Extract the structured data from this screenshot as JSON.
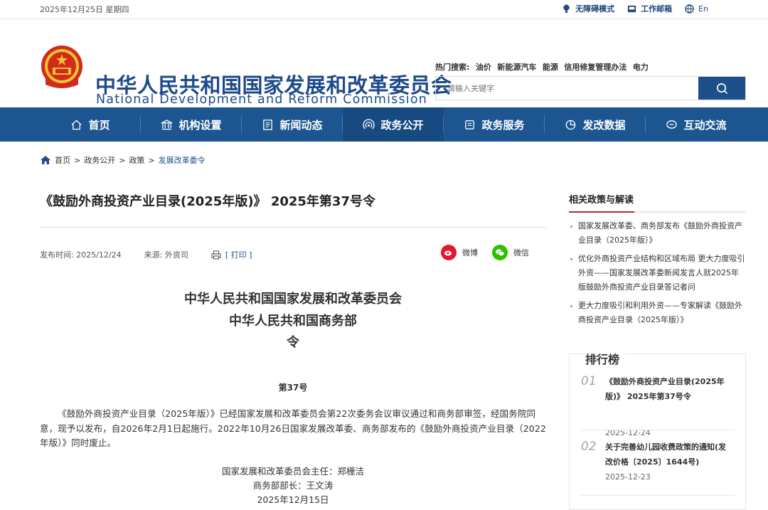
{
  "topbar": {
    "date": "2025年12月25日 星期四",
    "accessibility": "无障碍模式",
    "mail": "工作邮箱",
    "lang": "En"
  },
  "header": {
    "title_cn": "中华人民共和国国家发展和改革委员会",
    "title_en": "National Development and Reform Commission",
    "hot_label": "热门搜索:",
    "hot_keywords": [
      "油价",
      "新能源汽车",
      "能源",
      "信用修复管理办法",
      "电力"
    ],
    "search_placeholder": "请输入关键字"
  },
  "nav": {
    "items": [
      {
        "label": "首页",
        "icon": "home-icon"
      },
      {
        "label": "机构设置",
        "icon": "building-icon"
      },
      {
        "label": "新闻动态",
        "icon": "news-icon"
      },
      {
        "label": "政务公开",
        "icon": "broadcast-icon"
      },
      {
        "label": "政务服务",
        "icon": "service-icon"
      },
      {
        "label": "发改数据",
        "icon": "pie-chart-icon"
      },
      {
        "label": "互动交流",
        "icon": "chat-icon"
      }
    ]
  },
  "breadcrumb": {
    "home": "首页",
    "sep": ">",
    "level1": "政务公开",
    "level2": "政策",
    "current": "发展改革委令"
  },
  "article": {
    "title": "《鼓励外商投资产业目录(2025年版)》 2025年第37号令",
    "publish_label": "发布时间:",
    "publish_date": "2025/12/24",
    "source_label": "来源:",
    "source": "外资司",
    "print": "[ 打印 ]",
    "share_weibo": "微博",
    "share_wechat": "微信",
    "issuer1": "中华人民共和国国家发展和改革委员会",
    "issuer2": "中华人民共和国商务部",
    "doc_type": "令",
    "order_no": "第37号",
    "body": "《鼓励外商投资产业目录（2025年版）》已经国家发展和改革委员会第22次委务会议审议通过和商务部审签，经国务院同意，现予以发布，自2026年2月1日起施行。2022年10月26日国家发展改革委、商务部发布的《鼓励外商投资产业目录（2022年版）》同时废止。",
    "signer1": "国家发展和改革委员会主任：郑栅洁",
    "signer2": "商务部部长：王文涛",
    "sign_date": "2025年12月15日"
  },
  "sidebar": {
    "related_title": "相关政策与解读",
    "related": [
      "国家发展改革委、商务部发布《鼓励外商投资产业目录（2025年版）》",
      "优化外商投资产业结构和区域布局 更大力度吸引外资——国家发展改革委新闻发言人就2025年版鼓励外商投资产业目录答记者问",
      "更大力度吸引和利用外资——专家解读《鼓励外商投资产业目录（2025年版）》"
    ],
    "rank_title": "排行榜",
    "rank": [
      {
        "no": "01",
        "title": "《鼓励外商投资产业目录(2025年版)》 2025年第37号令",
        "date": "2025-12-24"
      },
      {
        "no": "02",
        "title": "关于完善幼儿园收费政策的通知(发改价格〔2025〕1644号)",
        "date": "2025-12-23"
      }
    ]
  },
  "colors": {
    "brand_blue": "#1c5590",
    "accent_red": "#b7282e"
  }
}
